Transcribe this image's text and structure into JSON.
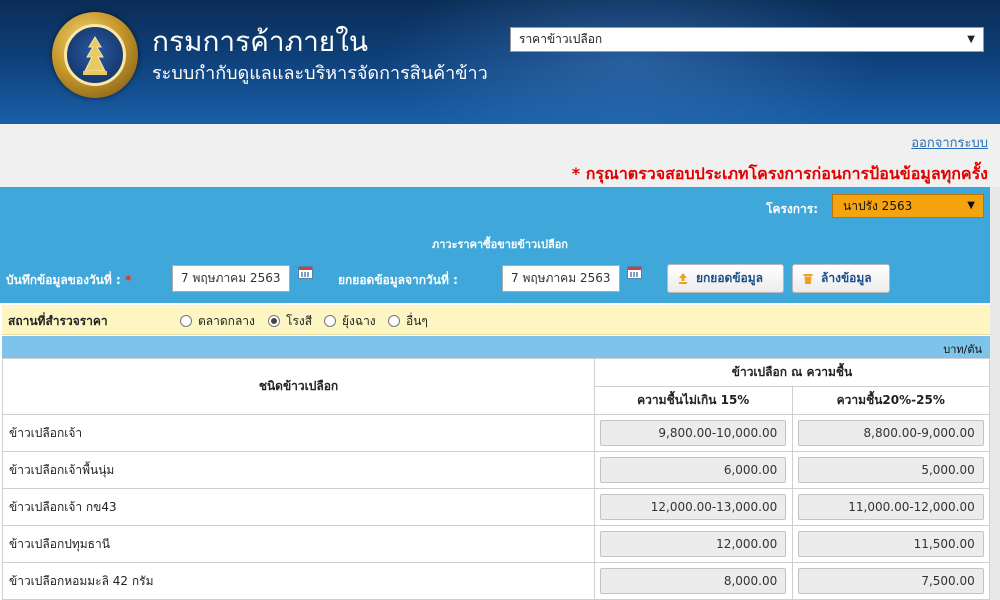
{
  "header": {
    "org_title": "กรมการค้าภายใน",
    "org_subtitle": "ระบบกำกับดูแลและบริหารจัดการสินค้าข้าว",
    "menu_select_value": "ราคาข้าวเปลือก",
    "seal_icon": "department-seal-icon"
  },
  "strip": {
    "logout_label": "ออกจากระบบ",
    "warning": "* กรุณาตรวจสอบประเภทโครงการก่อนการป้อนข้อมูลทุกครั้ง"
  },
  "form": {
    "project_label": "โครงการ:",
    "project_value": "นาปรัง 2563",
    "section_title": "ภาวะราคาซื้อขายข้าวเปลือก",
    "record_date_label": "บันทึกข้อมูลของวันที่ :",
    "record_date_required": "*",
    "record_date_value": "7 พฤษภาคม 2563",
    "carry_date_label": "ยกยอดข้อมูลจากวันที่ :",
    "carry_date_value": "7 พฤษภาคม 2563",
    "carry_button": "ยกยอดข้อมูล",
    "clear_button": "ล้างข้อมูล"
  },
  "location": {
    "title": "สถานที่สำรวจราคา",
    "options": [
      "ตลาดกลาง",
      "โรงสี",
      "ยุ้งฉาง",
      "อื่นๆ"
    ],
    "selected": "โรงสี"
  },
  "table": {
    "unit": "บาท/ตัน",
    "col_type": "ชนิดข้าวเปลือก",
    "col_group": "ข้าวเปลือก ณ ความชื้น",
    "col_a": "ความชื้นไม่เกิน 15%",
    "col_b": "ความชื้น20%-25%",
    "rows": [
      {
        "name": "ข้าวเปลือกเจ้า",
        "a": "9,800.00-10,000.00",
        "b": "8,800.00-9,000.00"
      },
      {
        "name": "ข้าวเปลือกเจ้าพื้นนุ่ม",
        "a": "6,000.00",
        "b": "5,000.00"
      },
      {
        "name": "ข้าวเปลือกเจ้า กข43",
        "a": "12,000.00-13,000.00",
        "b": "11,000.00-12,000.00"
      },
      {
        "name": "ข้าวเปลือกปทุมธานี",
        "a": "12,000.00",
        "b": "11,500.00"
      },
      {
        "name": "ข้าวเปลือกหอมมะลิ 42 กรัม",
        "a": "8,000.00",
        "b": "7,500.00"
      }
    ]
  },
  "colors": {
    "header_bg": "#0e3f78",
    "form_bg": "#3fa7d9",
    "project_select_bg": "#f5a30f",
    "warning": "#e00000",
    "location_bg": "#fdf6c3",
    "unit_bar_bg": "#7ec3ea"
  }
}
